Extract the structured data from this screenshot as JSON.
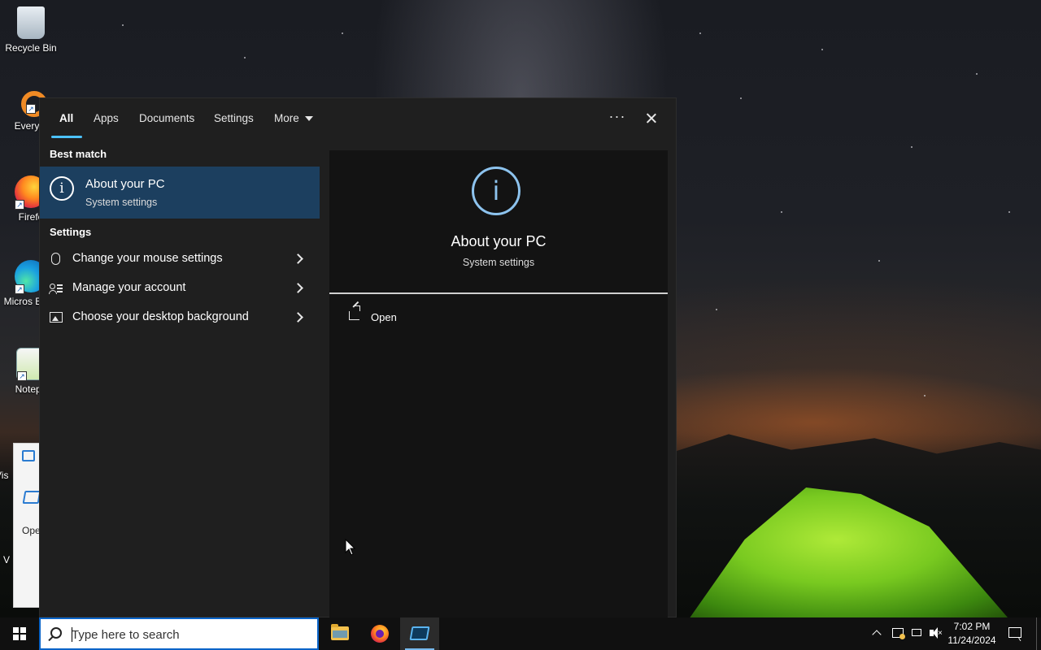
{
  "desktop": {
    "icons": [
      {
        "label": "Recycle Bin"
      },
      {
        "label": "Everyth"
      },
      {
        "label": "Firefo"
      },
      {
        "label": "Micros Edge"
      },
      {
        "label": "Notepa"
      },
      {
        "label": "Vis"
      },
      {
        "label": "V"
      }
    ],
    "bg_window": {
      "label": "Ope"
    }
  },
  "search_panel": {
    "tabs": [
      {
        "label": "All",
        "active": true
      },
      {
        "label": "Apps"
      },
      {
        "label": "Documents"
      },
      {
        "label": "Settings"
      },
      {
        "label": "More"
      }
    ],
    "ellipsis": "···",
    "best_match": {
      "section_label": "Best match",
      "title": "About your PC",
      "subtitle": "System settings"
    },
    "settings_section": {
      "section_label": "Settings",
      "items": [
        {
          "label": "Change your mouse settings",
          "icon": "mouse-icon"
        },
        {
          "label": "Manage your account",
          "icon": "account-icon"
        },
        {
          "label": "Choose your desktop background",
          "icon": "picture-icon"
        }
      ]
    },
    "preview": {
      "icon_glyph": "i",
      "title": "About your PC",
      "subtitle": "System settings",
      "actions": [
        {
          "label": "Open",
          "icon": "open-icon"
        }
      ]
    }
  },
  "taskbar": {
    "search": {
      "placeholder": "Type here to search"
    },
    "apps": [
      {
        "name": "File Explorer",
        "icon": "folder-icon"
      },
      {
        "name": "Firefox",
        "icon": "firefox-icon"
      },
      {
        "name": "Remote Desktop",
        "icon": "rdp-icon",
        "active": true
      }
    ],
    "clock": {
      "time": "7:02 PM",
      "date": "11/24/2024"
    }
  },
  "colors": {
    "accent": "#4cc2ff",
    "selected": "#1c3f5f",
    "panel": "#1f1f1f",
    "preview": "#131313",
    "info_blue": "#8dc3ee"
  }
}
